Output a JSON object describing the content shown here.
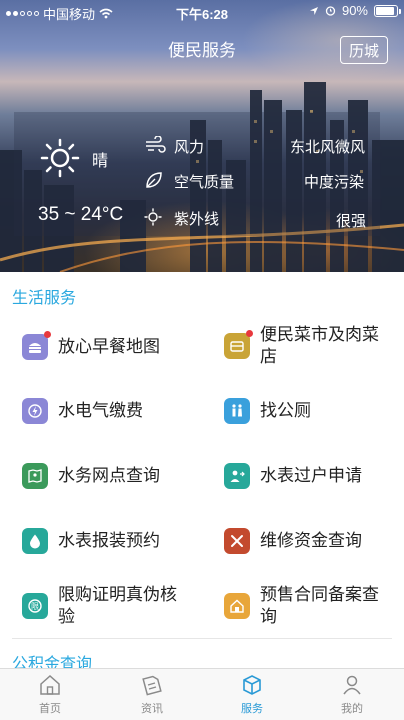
{
  "status_bar": {
    "carrier": "中国移动",
    "time": "下午6:28",
    "battery": "90%",
    "battery_level": 0.9
  },
  "header": {
    "title": "便民服务",
    "city_button": "历城"
  },
  "weather": {
    "condition": "晴",
    "temp_range": "35 ~ 24°C",
    "wind_label": "风力",
    "wind_value": "东北风微风",
    "air_label": "空气质量",
    "air_value": "中度污染",
    "uv_label": "紫外线",
    "uv_value": "很强"
  },
  "sections": {
    "life_title": "生活服务",
    "fund_title": "公积金查询"
  },
  "services": [
    {
      "label": "放心早餐地图",
      "icon": "breakfast-icon",
      "color": "#8b87d6",
      "badge": true
    },
    {
      "label": "便民菜市及肉菜店",
      "icon": "market-icon",
      "color": "#c9a437",
      "badge": true
    },
    {
      "label": "水电气缴费",
      "icon": "utility-icon",
      "color": "#8b87d6",
      "badge": false
    },
    {
      "label": "找公厕",
      "icon": "restroom-icon",
      "color": "#3aa0dc",
      "badge": false
    },
    {
      "label": "水务网点查询",
      "icon": "map-book-icon",
      "color": "#3b9a5b",
      "badge": false
    },
    {
      "label": "水表过户申请",
      "icon": "person-transfer-icon",
      "color": "#27a89a",
      "badge": false
    },
    {
      "label": "水表报装预约",
      "icon": "water-drop-icon",
      "color": "#27a89a",
      "badge": false
    },
    {
      "label": "维修资金查询",
      "icon": "tools-icon",
      "color": "#c34a2e",
      "badge": false
    },
    {
      "label": "限购证明真伪核验",
      "icon": "limit-icon",
      "color": "#27a89a",
      "badge": false
    },
    {
      "label": "预售合同备案查询",
      "icon": "house-icon",
      "color": "#e8a63a",
      "badge": false
    }
  ],
  "tabs": [
    {
      "label": "首页",
      "icon": "home-icon"
    },
    {
      "label": "资讯",
      "icon": "news-icon"
    },
    {
      "label": "服务",
      "icon": "service-box-icon"
    },
    {
      "label": "我的",
      "icon": "profile-icon"
    }
  ],
  "colors": {
    "accent": "#2aa8df",
    "tab_active": "#2a9ad6"
  }
}
